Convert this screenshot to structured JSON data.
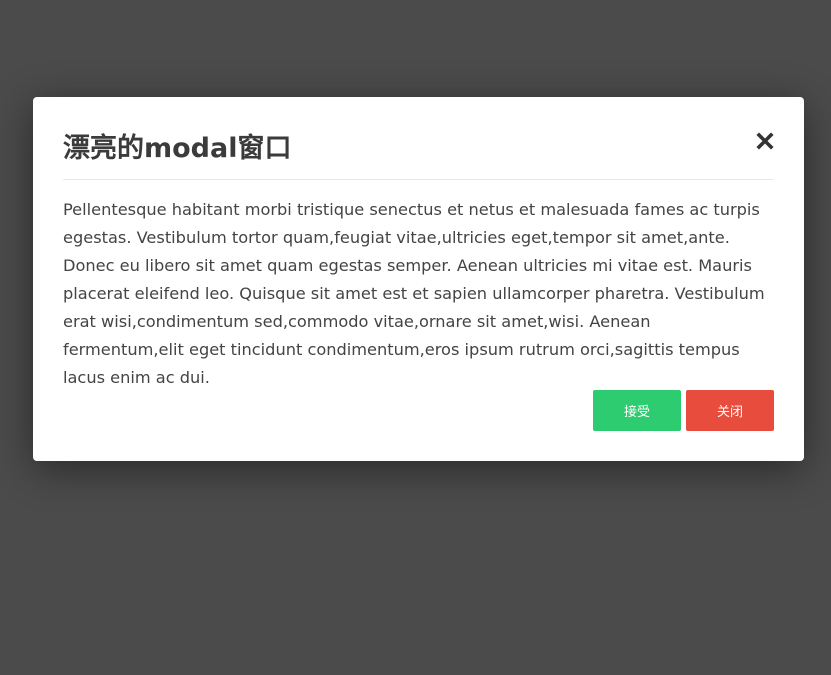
{
  "colors": {
    "backdrop": "#4b4b4b",
    "accept": "#2ecc71",
    "close": "#e74c3c"
  },
  "modal": {
    "title": "漂亮的modal窗口",
    "close_icon": "close-x-icon",
    "body": "Pellentesque habitant morbi tristique senectus et netus et malesuada fames ac turpis egestas. Vestibulum tortor quam,feugiat vitae,ultricies eget,tempor sit amet,ante. Donec eu libero sit amet quam egestas semper. Aenean ultricies mi vitae est. Mauris placerat eleifend leo. Quisque sit amet est et sapien ullamcorper pharetra. Vestibulum erat wisi,condimentum sed,commodo vitae,ornare sit amet,wisi. Aenean fermentum,elit eget tincidunt condimentum,eros ipsum rutrum orci,sagittis tempus lacus enim ac dui.",
    "buttons": {
      "accept_label": "接受",
      "close_label": "关闭"
    }
  }
}
